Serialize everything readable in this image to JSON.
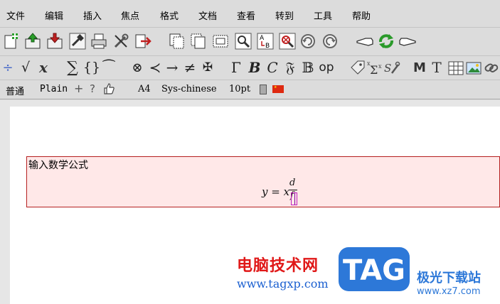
{
  "menu": {
    "file": "文件",
    "edit": "编辑",
    "insert": "插入",
    "focus": "焦点",
    "format": "格式",
    "document": "文档",
    "view": "查看",
    "goto": "转到",
    "tools": "工具",
    "help": "帮助"
  },
  "format_bar": {
    "style": "普通",
    "font_mode": "Plain",
    "plus": "+",
    "question": "?",
    "paper": "A4",
    "language": "Sys-chinese",
    "font_size": "10pt"
  },
  "math_toolbar": {
    "frac": "÷",
    "sqrt": "√",
    "x": "x",
    "sum": "∑",
    "braces": "{}",
    "wide": "⁀",
    "otimes": "⊗",
    "prec": "≺",
    "arrow": "→",
    "neq": "≠",
    "maltese": "✠",
    "gamma": "Γ",
    "bold_b": "B",
    "cal_c": "C",
    "frak_f": "𝔉",
    "bb_b": "𝔹",
    "op": "op",
    "M": "M",
    "T": "T"
  },
  "document": {
    "box_title": "输入数学公式",
    "formula": {
      "lhs": "y = x",
      "numerator": "d",
      "denominator": "f"
    }
  },
  "watermark": {
    "site_cn": "电脑技术网",
    "site_url": "www.tagxp.com",
    "logo_text": "TAG",
    "site_cn2": "极光下载站",
    "site_url2": "www.xz7.com"
  },
  "colors": {
    "math_box_bg": "#ffe8e8",
    "math_box_border": "#b52020",
    "watermark_red": "#e01818",
    "watermark_blue": "#1a5fd0",
    "logo_blue": "#2d78d8"
  }
}
